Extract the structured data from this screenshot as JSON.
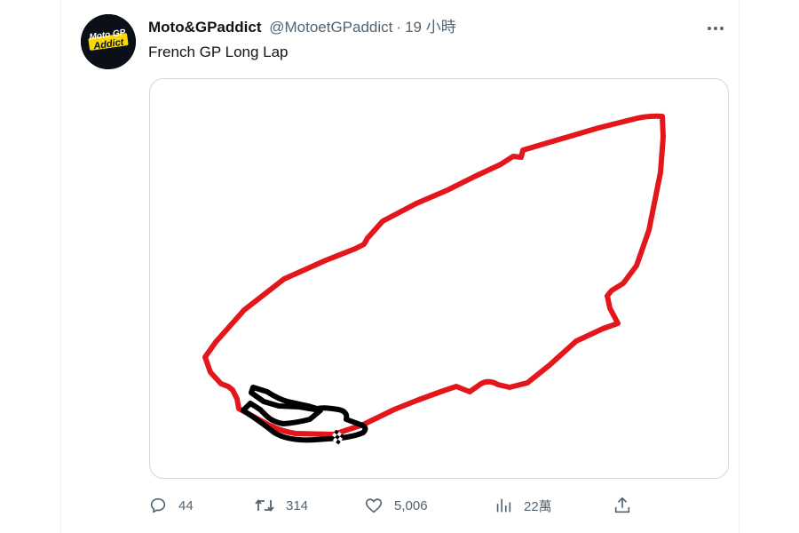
{
  "tweet": {
    "display_name": "Moto&GPaddict",
    "handle": "@MotoetGPaddict",
    "separator": "·",
    "timestamp": "19 小時",
    "text": "French GP Long Lap",
    "avatar_logo": [
      "Moto GP",
      "Addict"
    ]
  },
  "actions": {
    "reply": {
      "icon": "reply-icon",
      "count": "44"
    },
    "retweet": {
      "icon": "retweet-icon",
      "count": "314"
    },
    "like": {
      "icon": "heart-icon",
      "count": "5,006"
    },
    "views": {
      "icon": "views-icon",
      "count": "22萬"
    },
    "share": {
      "icon": "share-icon"
    }
  },
  "colors": {
    "track": "#e3171b",
    "long_lap": "#000000",
    "secondary_text": "#536471",
    "primary_text": "#0f1419",
    "avatar_bg": "#0b0f17",
    "avatar_logo": "#f5d90a"
  }
}
